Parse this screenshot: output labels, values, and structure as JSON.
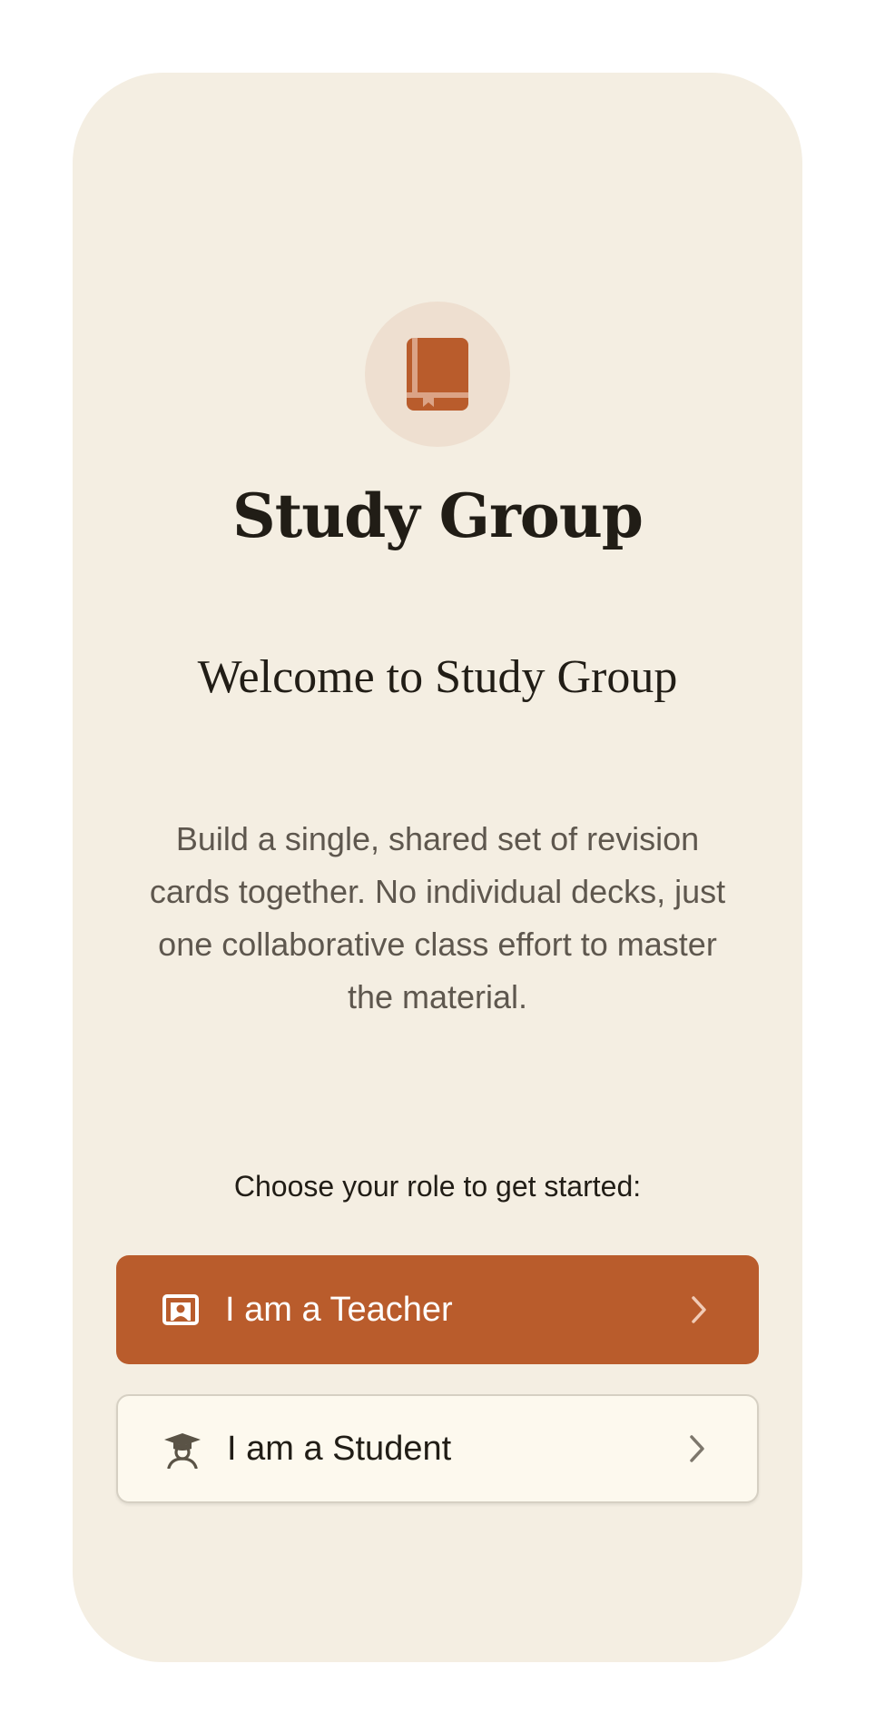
{
  "app": {
    "title": "Study Group",
    "logo_icon": "book-icon"
  },
  "welcome": {
    "heading": "Welcome to Study Group",
    "description": "Build a single, shared set of revision cards together. No individual decks, just one collaborative class effort to master the material."
  },
  "roles": {
    "prompt": "Choose your role to get started:",
    "teacher": {
      "label": "I am a Teacher",
      "icon": "presentation-teacher-icon"
    },
    "student": {
      "label": "I am a Student",
      "icon": "graduate-student-icon"
    }
  },
  "colors": {
    "accent": "#b95c2c",
    "background": "#f4eee2",
    "logo_circle": "#eedfd0",
    "text_dark": "#211d16",
    "text_muted": "#5e574e"
  }
}
